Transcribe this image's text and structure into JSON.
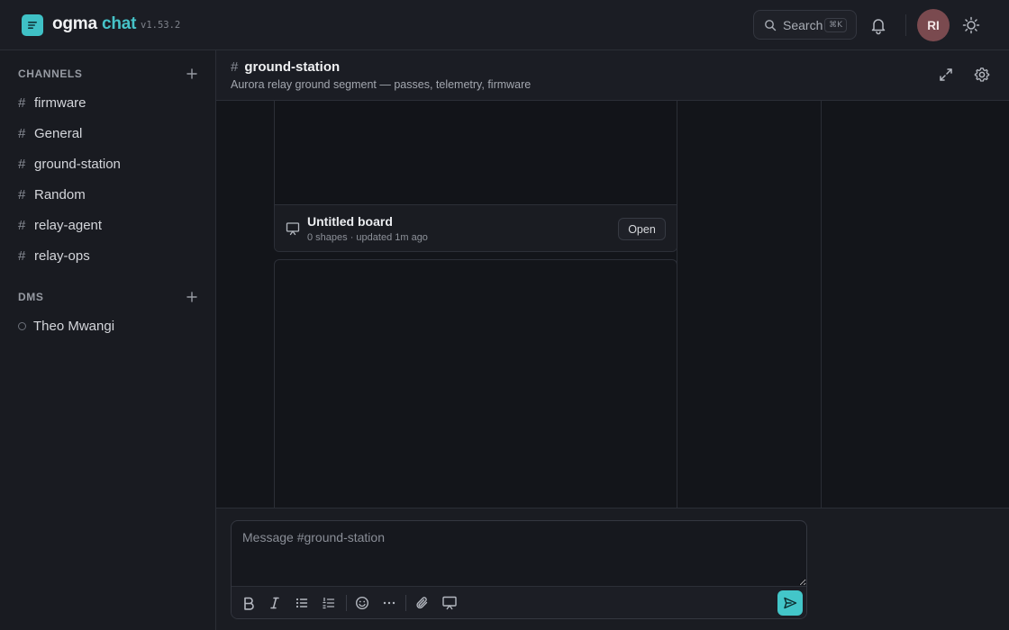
{
  "app": {
    "brand_first": "ogma",
    "brand_second": "chat",
    "version": "v1.53.2",
    "accent_color": "#43c6c9"
  },
  "topbar": {
    "search_label": "Search",
    "search_shortcut": "⌘K",
    "avatar_initials": "RI",
    "icons": [
      "search-icon",
      "bell-icon",
      "sun-icon"
    ]
  },
  "sidebar": {
    "channels_title": "CHANNELS",
    "channels": [
      {
        "label": "firmware"
      },
      {
        "label": "General"
      },
      {
        "label": "ground-station"
      },
      {
        "label": "Random"
      },
      {
        "label": "relay-agent"
      },
      {
        "label": "relay-ops"
      }
    ],
    "dms_title": "DMS",
    "dms": [
      {
        "label": "Theo Mwangi"
      }
    ]
  },
  "channel": {
    "name": "ground-station",
    "description": "Aurora relay ground segment — passes, telemetry, firmware"
  },
  "messages": {
    "board_card": {
      "title": "Untitled board",
      "meta": "0 shapes · updated 1m ago",
      "open_label": "Open"
    }
  },
  "composer": {
    "placeholder": "Message #ground-station",
    "tools": [
      "bold-icon",
      "italic-icon",
      "bullet-list-icon",
      "numbered-list-icon",
      "emoji-icon",
      "more-icon",
      "attach-icon",
      "whiteboard-icon",
      "send-icon"
    ]
  }
}
